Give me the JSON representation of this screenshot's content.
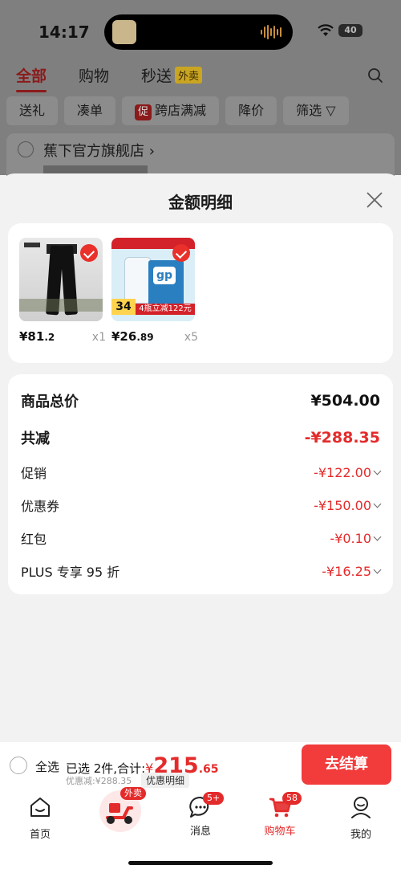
{
  "status_bar": {
    "time": "14:17",
    "battery": "40"
  },
  "top_tabs": [
    {
      "label": "全部",
      "active": true
    },
    {
      "label": "购物",
      "active": false
    },
    {
      "label": "秒送",
      "badge": "外卖",
      "active": false
    }
  ],
  "filters": [
    {
      "label": "送礼"
    },
    {
      "label": "凑单"
    },
    {
      "label": "跨店满减",
      "tag": "促"
    },
    {
      "label": "降价"
    },
    {
      "label": "筛选"
    }
  ],
  "shop": {
    "name": "蕉下官方旗舰店"
  },
  "sheet": {
    "title": "金额明细",
    "products": [
      {
        "price_int": "¥81",
        "price_dec": ".2",
        "qty": "x1",
        "image": "black-pants"
      },
      {
        "price_int": "¥26",
        "price_dec": ".89",
        "qty": "x5",
        "image": "avizor-solution",
        "image_tag": "34",
        "image_strip": "4瓶立减122元"
      }
    ],
    "details": [
      {
        "label": "商品总价",
        "amount": "¥504.00",
        "style": "total"
      },
      {
        "label": "共减",
        "amount": "-¥288.35",
        "style": "reduce"
      },
      {
        "label": "促销",
        "amount": "-¥122.00",
        "expandable": true
      },
      {
        "label": "优惠券",
        "amount": "-¥150.00",
        "expandable": true
      },
      {
        "label": "红包",
        "amount": "-¥0.10",
        "expandable": true
      },
      {
        "label": "PLUS 专享 95 折",
        "amount": "-¥16.25",
        "expandable": true
      }
    ]
  },
  "checkout": {
    "select_all": "全选",
    "summary_prefix": "已选 2件,合计:",
    "yen": "¥",
    "total_int": "215",
    "total_dec": ".65",
    "discount_note": "优惠减:¥288.35",
    "detail_link": "优惠明细",
    "pay_button": "去结算"
  },
  "tabbar": [
    {
      "label": "首页",
      "icon": "home-icon"
    },
    {
      "label": "",
      "icon": "scooter-icon",
      "badge": "外卖"
    },
    {
      "label": "消息",
      "icon": "message-icon",
      "badge": "5+"
    },
    {
      "label": "购物车",
      "icon": "cart-icon",
      "badge": "58",
      "active": true
    },
    {
      "label": "我的",
      "icon": "profile-icon"
    }
  ],
  "colors": {
    "accent": "#e42b2b",
    "pay_button": "#f23b3b",
    "overlay": "#7f7f7f"
  }
}
